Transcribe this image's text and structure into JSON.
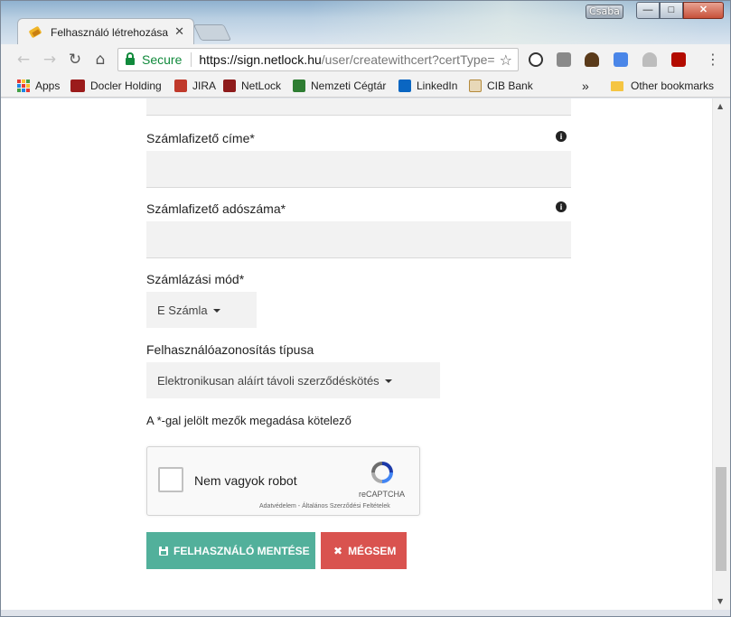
{
  "window": {
    "user_badge": "Csaba",
    "minimize_glyph": "—",
    "maximize_glyph": "□",
    "close_glyph": "✕"
  },
  "tab": {
    "title": "Felhasználó létrehozása",
    "close_glyph": "✕"
  },
  "toolbar": {
    "back_glyph": "←",
    "forward_glyph": "→",
    "reload_glyph": "↻",
    "home_glyph": "⌂",
    "secure_label": "Secure",
    "url_host": "https://sign.netlock.hu",
    "url_path": "/user/createwithcert?certType=",
    "star_glyph": "☆",
    "menu_glyph": "⋮"
  },
  "bookmarks": {
    "items": [
      {
        "label": "Apps"
      },
      {
        "label": "Docler Holding"
      },
      {
        "label": "JIRA"
      },
      {
        "label": "NetLock"
      },
      {
        "label": "Nemzeti Cégtár"
      },
      {
        "label": "LinkedIn"
      },
      {
        "label": "CIB Bank"
      }
    ],
    "overflow_glyph": "»",
    "other_label": "Other bookmarks"
  },
  "form": {
    "payer_address": {
      "label": "Számlafizető címe*",
      "value": ""
    },
    "payer_tax_number": {
      "label": "Számlafizető adószáma*",
      "value": ""
    },
    "billing_mode": {
      "label": "Számlázási mód*",
      "selected": "E Számla"
    },
    "identification_type": {
      "label": "Felhasználóazonosítás típusa",
      "selected": "Elektronikusan aláírt távoli szerződéskötés"
    },
    "required_note": "A *-gal jelölt mezők megadása kötelező",
    "info_glyph": "i"
  },
  "captcha": {
    "label": "Nem vagyok robot",
    "brand": "reCAPTCHA",
    "links": "Adatvédelem - Általános Szerződési Feltételek"
  },
  "buttons": {
    "save_label": "FELHASZNÁLÓ MENTÉSE",
    "cancel_label": "MÉGSEM",
    "cancel_glyph": "✖"
  },
  "scrollbar": {
    "up_glyph": "▲",
    "down_glyph": "▼",
    "position": 0.92
  },
  "colors": {
    "save_button": "#52b09b",
    "cancel_button": "#d9534f",
    "secure_green": "#118a3c"
  }
}
